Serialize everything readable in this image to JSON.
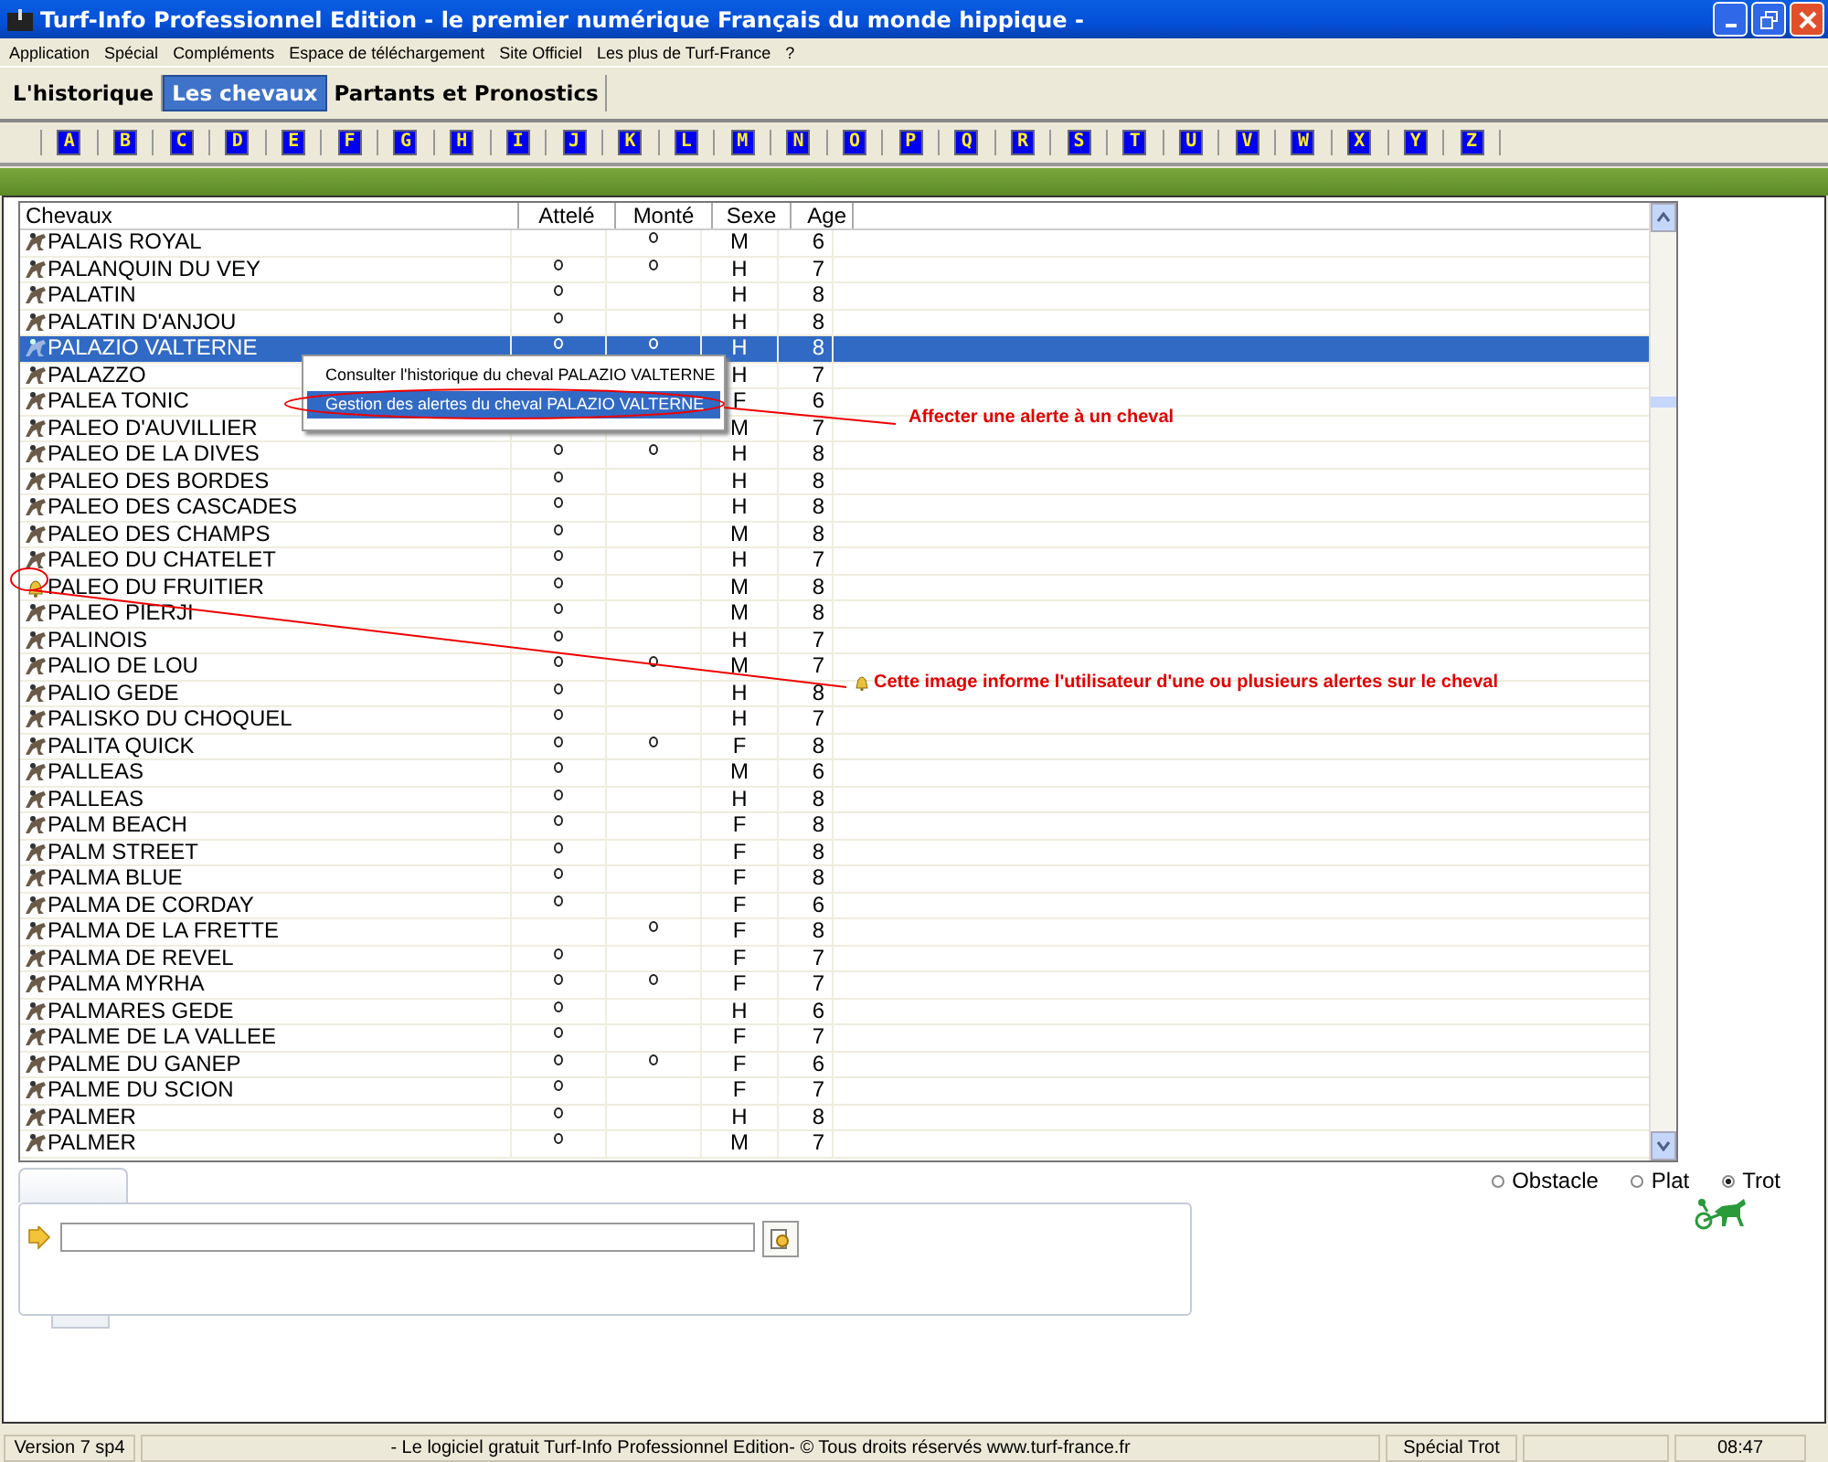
{
  "window": {
    "title": "Turf-Info Professionnel Edition - le premier numérique Français du monde hippique -"
  },
  "menu": [
    "Application",
    "Spécial",
    "Compléments",
    "Espace de téléchargement",
    "Site Officiel",
    "Les plus de Turf-France",
    "?"
  ],
  "tabs": [
    {
      "label": "L'historique",
      "selected": false
    },
    {
      "label": "Les chevaux",
      "selected": true
    },
    {
      "label": "Partants et Pronostics",
      "selected": false
    }
  ],
  "letters": [
    "A",
    "B",
    "C",
    "D",
    "E",
    "F",
    "G",
    "H",
    "I",
    "J",
    "K",
    "L",
    "M",
    "N",
    "O",
    "P",
    "Q",
    "R",
    "S",
    "T",
    "U",
    "V",
    "W",
    "X",
    "Y",
    "Z"
  ],
  "table": {
    "columns": [
      "Chevaux",
      "Attelé",
      "Monté",
      "Sexe",
      "Age"
    ],
    "rows": [
      {
        "kind": "horse",
        "name": "PALAIS ROYAL",
        "attele": false,
        "monte": true,
        "sexe": "M",
        "age": "6",
        "selected": false
      },
      {
        "kind": "horse",
        "name": "PALANQUIN DU VEY",
        "attele": true,
        "monte": true,
        "sexe": "H",
        "age": "7",
        "selected": false
      },
      {
        "kind": "horse",
        "name": "PALATIN",
        "attele": true,
        "monte": false,
        "sexe": "H",
        "age": "8",
        "selected": false
      },
      {
        "kind": "horse",
        "name": "PALATIN D'ANJOU",
        "attele": true,
        "monte": false,
        "sexe": "H",
        "age": "8",
        "selected": false
      },
      {
        "kind": "horse",
        "name": "PALAZIO VALTERNE",
        "attele": true,
        "monte": true,
        "sexe": "H",
        "age": "8",
        "selected": true
      },
      {
        "kind": "horse",
        "name": "PALAZZO",
        "sexe": "H",
        "age": "7",
        "selected": false
      },
      {
        "kind": "horse",
        "name": "PALEA TONIC",
        "sexe": "F",
        "age": "6",
        "selected": false
      },
      {
        "kind": "horse",
        "name": "PALEO D'AUVILLIER",
        "sexe": "M",
        "age": "7",
        "selected": false
      },
      {
        "kind": "horse",
        "name": "PALEO DE LA DIVES",
        "attele": true,
        "monte": true,
        "sexe": "H",
        "age": "8",
        "selected": false
      },
      {
        "kind": "horse",
        "name": "PALEO DES BORDES",
        "attele": true,
        "monte": false,
        "sexe": "H",
        "age": "8",
        "selected": false
      },
      {
        "kind": "horse",
        "name": "PALEO DES CASCADES",
        "attele": true,
        "monte": false,
        "sexe": "H",
        "age": "8",
        "selected": false
      },
      {
        "kind": "horse",
        "name": "PALEO DES CHAMPS",
        "attele": true,
        "monte": false,
        "sexe": "M",
        "age": "8",
        "selected": false
      },
      {
        "kind": "horse",
        "name": "PALEO DU CHATELET",
        "attele": true,
        "monte": false,
        "sexe": "H",
        "age": "7",
        "selected": false
      },
      {
        "kind": "alert",
        "name": "PALEO DU FRUITIER",
        "attele": true,
        "monte": false,
        "sexe": "M",
        "age": "8",
        "selected": false
      },
      {
        "kind": "horse",
        "name": "PALEO PIERJI",
        "attele": true,
        "monte": false,
        "sexe": "M",
        "age": "8",
        "selected": false
      },
      {
        "kind": "horse",
        "name": "PALINOIS",
        "attele": true,
        "monte": false,
        "sexe": "H",
        "age": "7",
        "selected": false
      },
      {
        "kind": "horse",
        "name": "PALIO DE LOU",
        "attele": true,
        "monte": true,
        "sexe": "M",
        "age": "7",
        "selected": false
      },
      {
        "kind": "horse",
        "name": "PALIO GEDE",
        "attele": true,
        "monte": false,
        "sexe": "H",
        "age": "8",
        "selected": false
      },
      {
        "kind": "horse",
        "name": "PALISKO DU CHOQUEL",
        "attele": true,
        "monte": false,
        "sexe": "H",
        "age": "7",
        "selected": false
      },
      {
        "kind": "horse",
        "name": "PALITA QUICK",
        "attele": true,
        "monte": true,
        "sexe": "F",
        "age": "8",
        "selected": false
      },
      {
        "kind": "horse",
        "name": "PALLEAS",
        "attele": true,
        "monte": false,
        "sexe": "M",
        "age": "6",
        "selected": false
      },
      {
        "kind": "horse",
        "name": "PALLEAS",
        "attele": true,
        "monte": false,
        "sexe": "H",
        "age": "8",
        "selected": false
      },
      {
        "kind": "horse",
        "name": "PALM BEACH",
        "attele": true,
        "monte": false,
        "sexe": "F",
        "age": "8",
        "selected": false
      },
      {
        "kind": "horse",
        "name": "PALM STREET",
        "attele": true,
        "monte": false,
        "sexe": "F",
        "age": "8",
        "selected": false
      },
      {
        "kind": "horse",
        "name": "PALMA BLUE",
        "attele": true,
        "monte": false,
        "sexe": "F",
        "age": "8",
        "selected": false
      },
      {
        "kind": "horse",
        "name": "PALMA DE CORDAY",
        "attele": true,
        "monte": false,
        "sexe": "F",
        "age": "6",
        "selected": false
      },
      {
        "kind": "horse",
        "name": "PALMA DE LA FRETTE",
        "attele": false,
        "monte": true,
        "sexe": "F",
        "age": "8",
        "selected": false
      },
      {
        "kind": "horse",
        "name": "PALMA DE REVEL",
        "attele": true,
        "monte": false,
        "sexe": "F",
        "age": "7",
        "selected": false
      },
      {
        "kind": "horse",
        "name": "PALMA MYRHA",
        "attele": true,
        "monte": true,
        "sexe": "F",
        "age": "7",
        "selected": false
      },
      {
        "kind": "horse",
        "name": "PALMARES GEDE",
        "attele": true,
        "monte": false,
        "sexe": "H",
        "age": "6",
        "selected": false
      },
      {
        "kind": "horse",
        "name": "PALME DE LA VALLEE",
        "attele": true,
        "monte": false,
        "sexe": "F",
        "age": "7",
        "selected": false
      },
      {
        "kind": "horse",
        "name": "PALME DU GANEP",
        "attele": true,
        "monte": true,
        "sexe": "F",
        "age": "6",
        "selected": false
      },
      {
        "kind": "horse",
        "name": "PALME DU SCION",
        "attele": true,
        "monte": false,
        "sexe": "F",
        "age": "7",
        "selected": false
      },
      {
        "kind": "horse",
        "name": "PALMER",
        "attele": true,
        "monte": false,
        "sexe": "H",
        "age": "8",
        "selected": false
      },
      {
        "kind": "horse",
        "name": "PALMER",
        "attele": true,
        "monte": false,
        "sexe": "M",
        "age": "7",
        "selected": false
      }
    ]
  },
  "context_menu": [
    {
      "label": "Consulter l'historique du cheval PALAZIO VALTERNE",
      "selected": false
    },
    {
      "label": "Gestion des alertes du cheval PALAZIO VALTERNE",
      "selected": true
    }
  ],
  "annotations": [
    "Affecter une alerte à un cheval",
    "Cette image informe l'utilisateur d'une ou plusieurs alertes sur le cheval"
  ],
  "race_types": [
    {
      "label": "Obstacle",
      "selected": false
    },
    {
      "label": "Plat",
      "selected": false
    },
    {
      "label": "Trot",
      "selected": true
    }
  ],
  "status_bar": [
    "Version 7 sp4",
    "- Le logiciel gratuit Turf-Info Professionnel Edition- © Tous droits réservés www.turf-france.fr",
    "Spécial Trot",
    "08:47"
  ]
}
